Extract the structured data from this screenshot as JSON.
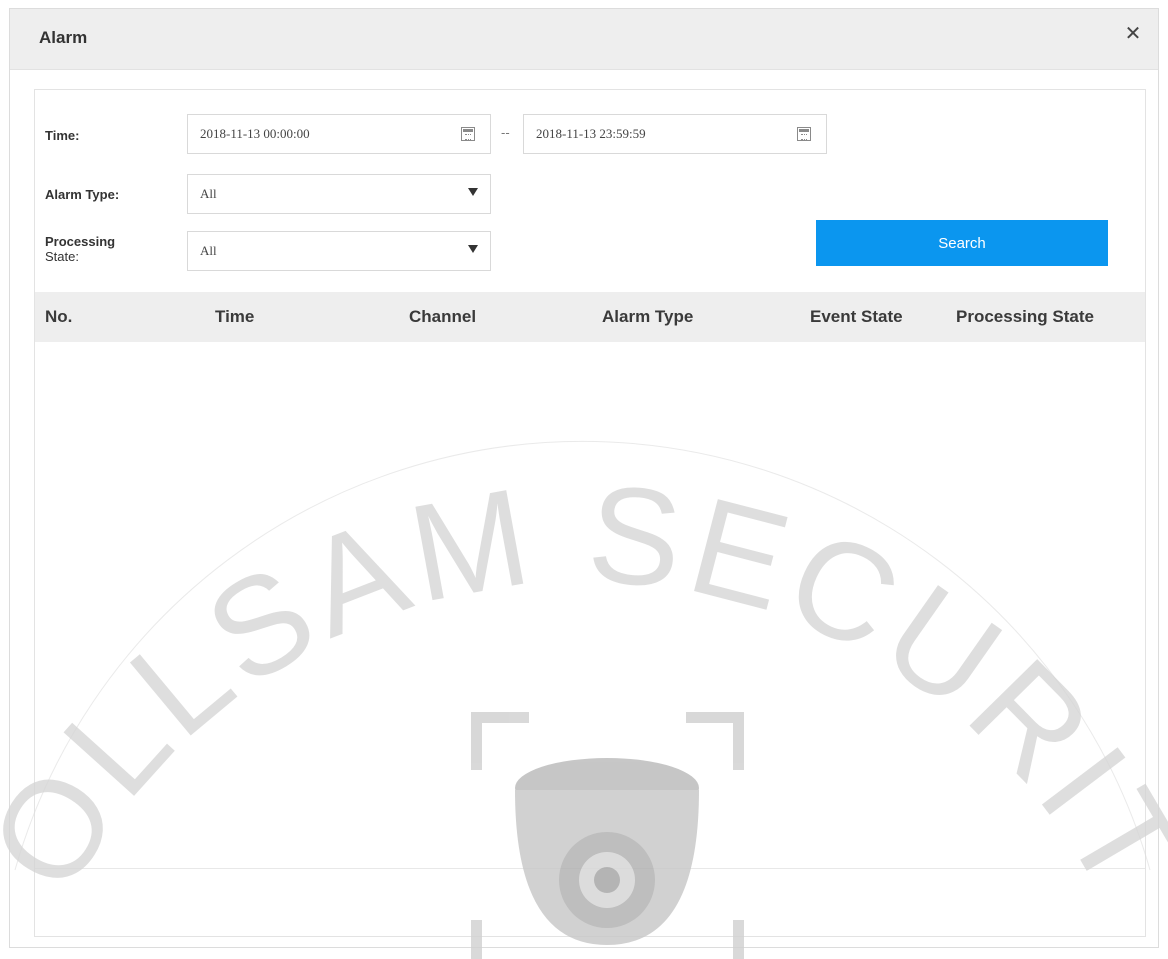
{
  "dialog": {
    "title": "Alarm",
    "close_icon": "close-icon"
  },
  "filters": {
    "time_label": "Time:",
    "start_time": "2018-11-13 00:00:00",
    "separator": "--",
    "end_time": "2018-11-13 23:59:59",
    "calendar_icon": "calendar-icon",
    "alarm_type_label": "Alarm Type:",
    "alarm_type_value": "All",
    "processing_state_label_line1": "Processing",
    "processing_state_label_line2": "State:",
    "processing_state_value": "All",
    "dropdown_icon": "chevron-down-icon",
    "search_label": "Search"
  },
  "table": {
    "columns": [
      "No.",
      "Time",
      "Channel",
      "Alarm Type",
      "Event State",
      "Processing State"
    ],
    "rows": []
  },
  "watermark": {
    "text": "COLLSAM SECURITY",
    "icon": "dome-camera-icon"
  },
  "colors": {
    "accent": "#0b96ef",
    "header_bg": "#eeeeee",
    "border": "#d9d9d9"
  }
}
